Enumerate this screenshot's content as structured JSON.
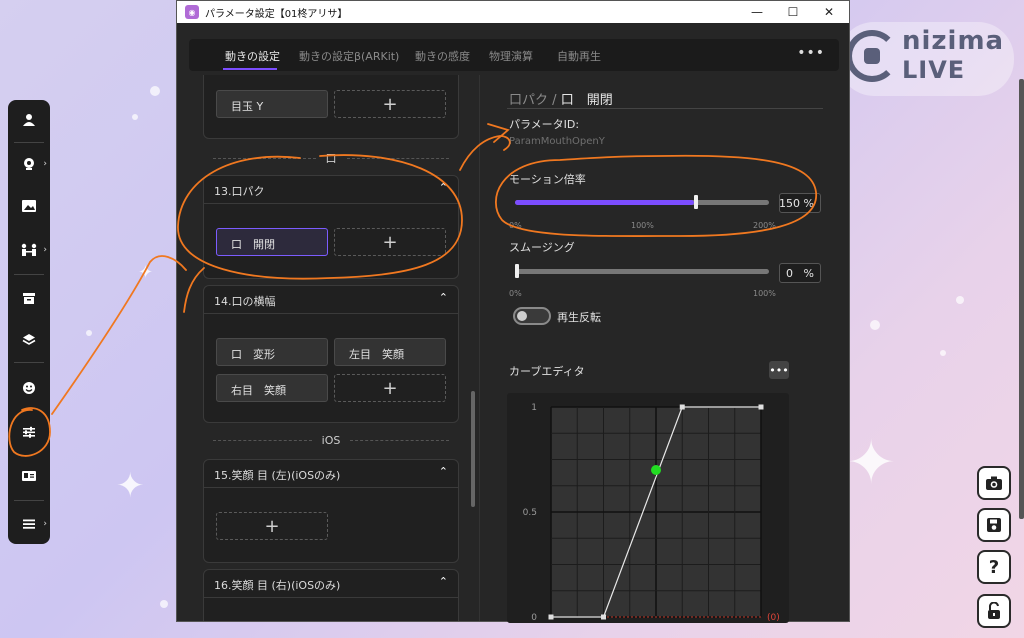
{
  "logo": {
    "line1": "nizima",
    "line2": "LIVE"
  },
  "window": {
    "title": "パラメータ設定【01柊アリサ】",
    "minimize": "—",
    "maximize": "☐",
    "close": "✕"
  },
  "tabs": [
    {
      "label": "動きの設定"
    },
    {
      "label": "動きの設定β(ARKit)"
    },
    {
      "label": "動きの感度"
    },
    {
      "label": "物理演算"
    },
    {
      "label": "自動再生"
    }
  ],
  "tabs_more": "•••",
  "left": {
    "top_card": {
      "pill": "目玉 Y",
      "add": "+"
    },
    "section_mouth": "口",
    "card13": {
      "title": "13.口パク",
      "caret": "⌃",
      "pill": "口　開閉",
      "add": "+"
    },
    "card14": {
      "title": "14.口の横幅",
      "caret": "⌃",
      "pills": [
        "口　変形",
        "左目　笑顔",
        "右目　笑顔"
      ],
      "add": "+"
    },
    "section_ios": "iOS",
    "card15": {
      "title": "15.笑顔 目 (左)(iOSのみ)",
      "caret": "⌃",
      "add": "+"
    },
    "card16": {
      "title": "16.笑顔 目 (右)(iOSのみ)",
      "caret": "⌃"
    }
  },
  "right": {
    "crumb_group": "口パク",
    "crumb_sep": "/",
    "crumb_item": "口　開閉",
    "param_id_label": "パラメータID:",
    "param_id_value": "ParamMouthOpenY",
    "motion_label": "モーション倍率",
    "motion_value": "150",
    "motion_unit": "%",
    "motion_fraction": 0.75,
    "motion_ticks": [
      "0%",
      "100%",
      "200%"
    ],
    "smoothing_label": "スムージング",
    "smoothing_value": "0",
    "smoothing_unit": "%",
    "smoothing_fraction": 0.0,
    "smoothing_ticks": [
      "0%",
      "100%"
    ],
    "reverse_label": "再生反転",
    "reverse_on": false,
    "curve_label": "カーブエディタ",
    "curve_more": "•••",
    "curve_y_ticks": [
      "1",
      "0.5",
      "0"
    ],
    "curve_zero_marker": "(0)",
    "curve_points": [
      [
        0,
        0
      ],
      [
        0.25,
        0
      ],
      [
        0.625,
        1
      ],
      [
        1,
        1
      ]
    ],
    "curve_current": [
      0.5,
      0.7
    ]
  },
  "side_buttons": [
    {
      "name": "camera-icon",
      "glyph": "◙"
    },
    {
      "name": "save-icon",
      "glyph": "▣"
    },
    {
      "name": "help-icon",
      "glyph": "?"
    },
    {
      "name": "lock-icon",
      "glyph": "🔓"
    }
  ],
  "colors": {
    "accent": "#7c4dff",
    "annotation": "#f07820",
    "active_point": "#22dd22"
  }
}
